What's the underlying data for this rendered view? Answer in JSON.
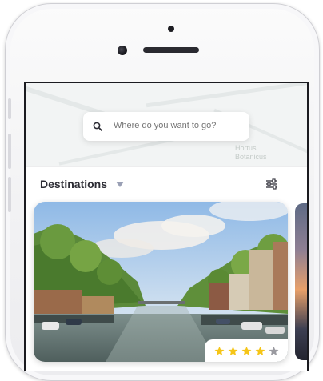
{
  "search": {
    "placeholder": "Where do you want to go?"
  },
  "map": {
    "label": "Hortus Botanicus"
  },
  "section": {
    "title": "Destinations"
  },
  "rating": {
    "value": 4,
    "max": 5,
    "filled_color": "#f5c518",
    "empty_color": "#9a9aa0"
  },
  "colors": {
    "text_primary": "#2c2c34",
    "placeholder": "#a3a3a8",
    "icon_muted": "#9aa0b5"
  },
  "icons": {
    "search": "search-icon",
    "dropdown": "chevron-down-icon",
    "filter": "filter-sliders-icon",
    "star": "star-icon"
  }
}
